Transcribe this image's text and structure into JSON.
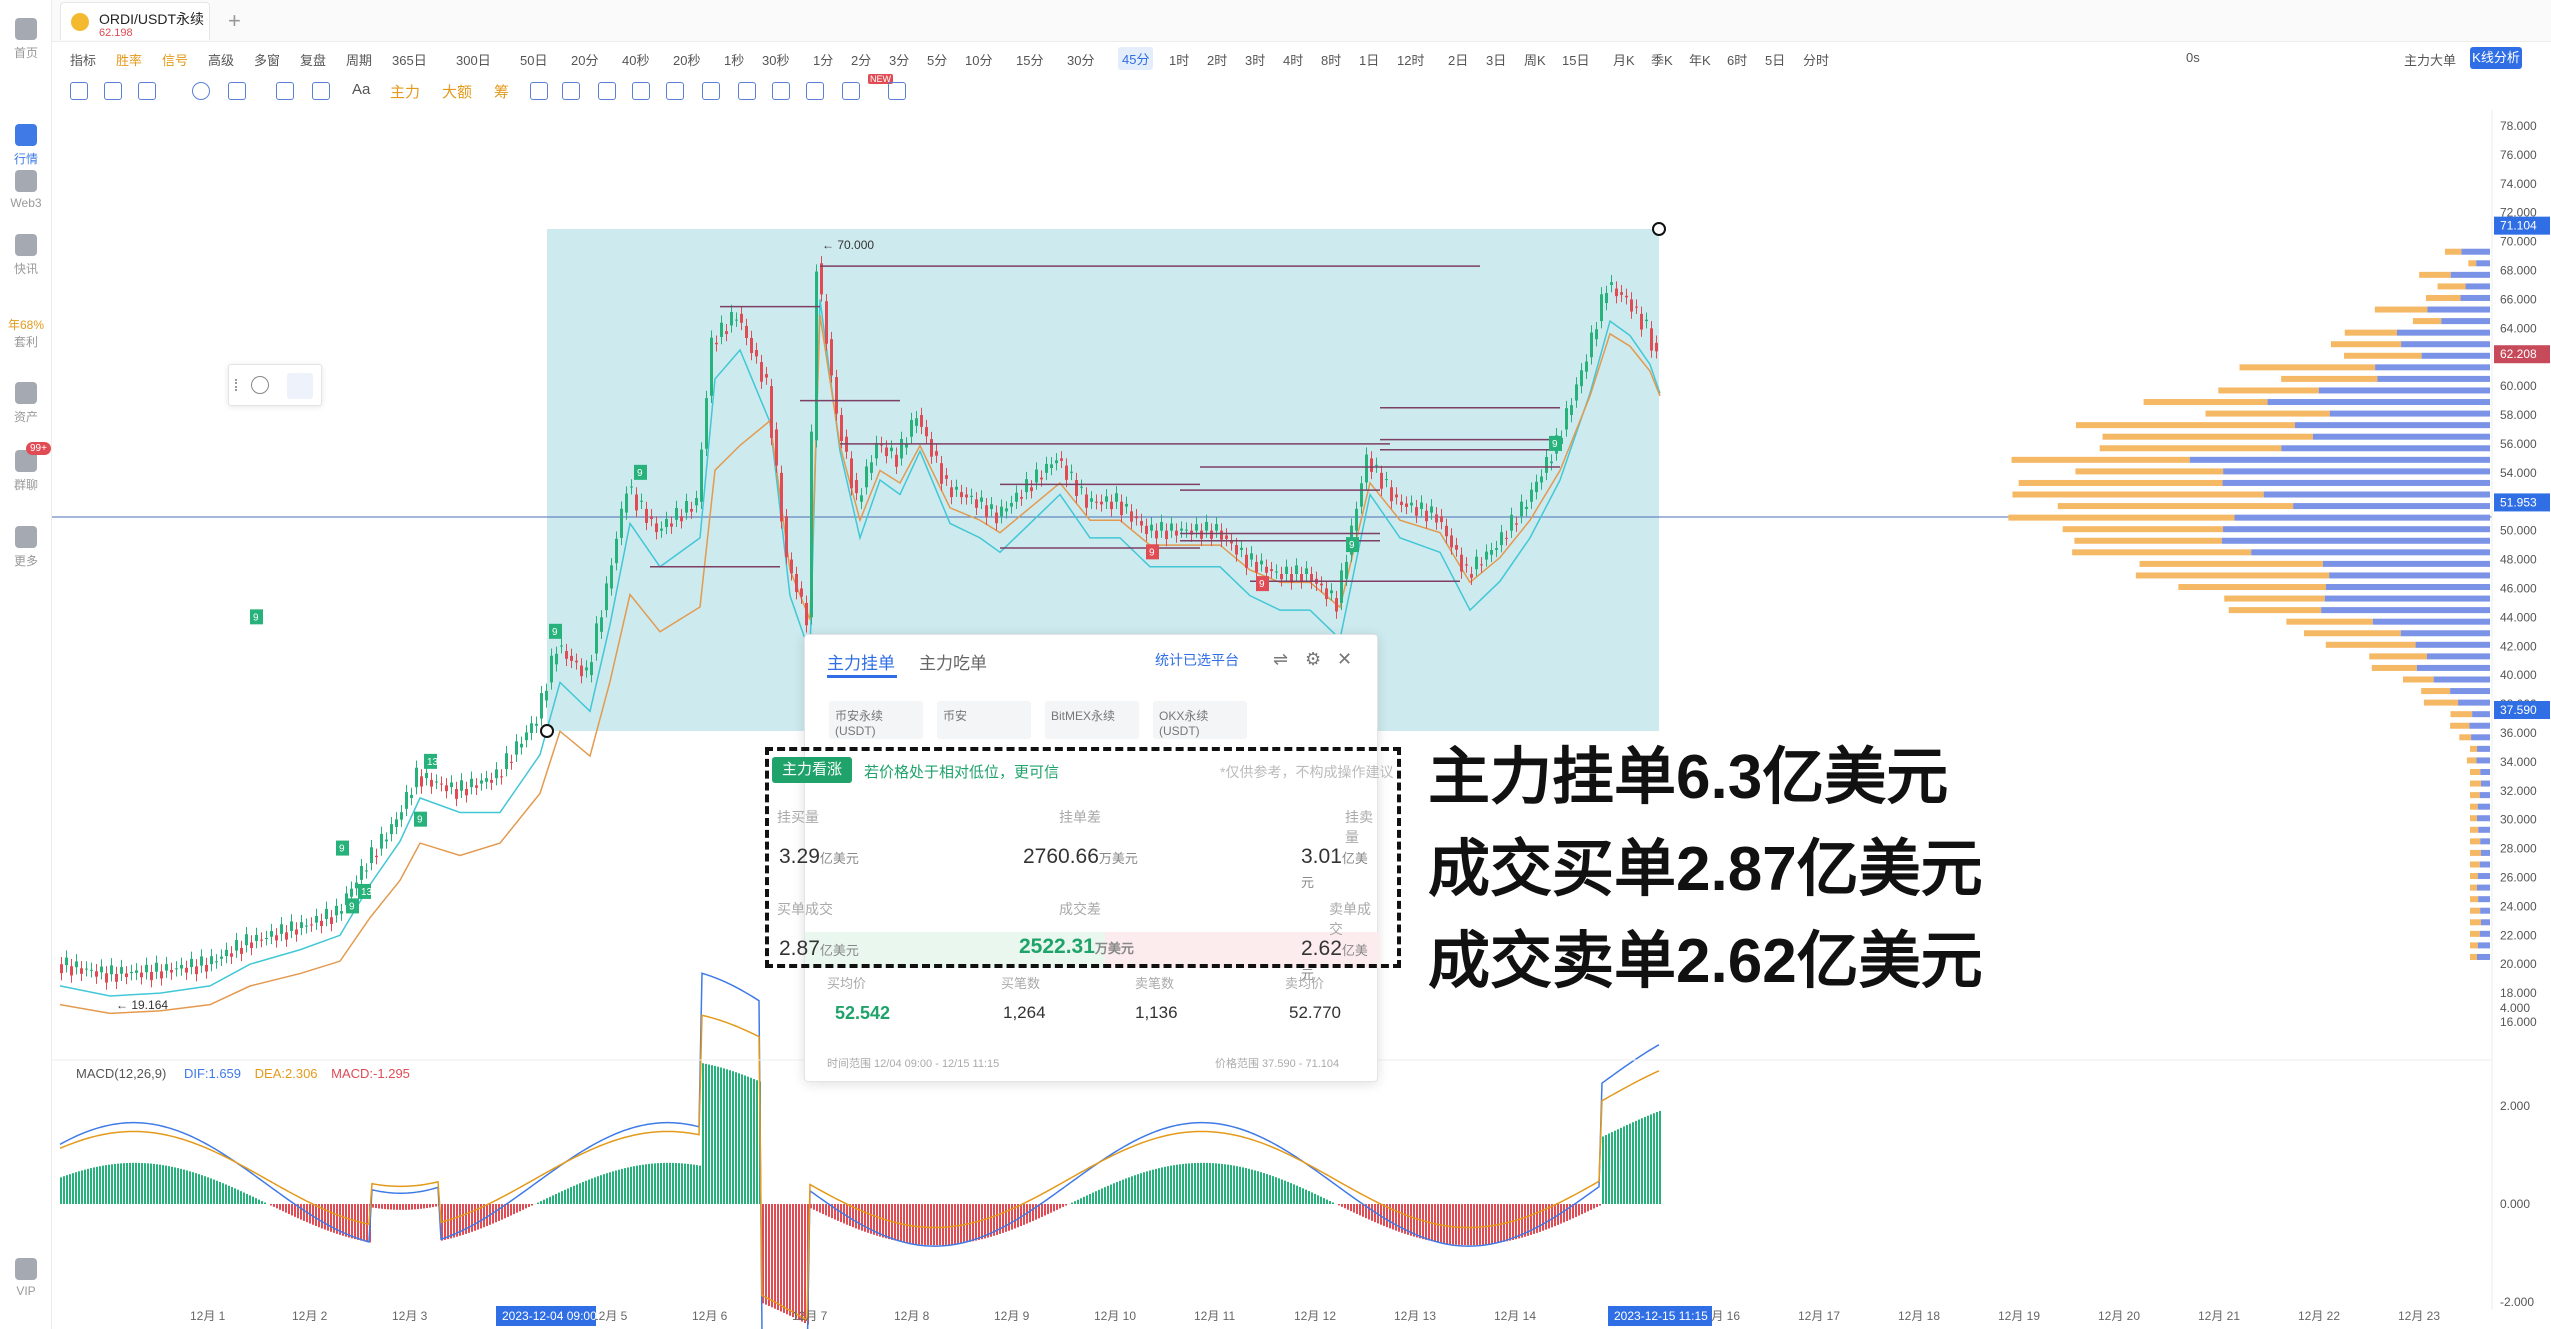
{
  "sidebar": {
    "items": [
      {
        "label": "首页",
        "icon": "home-icon"
      },
      {
        "label": "行情",
        "icon": "market-chart-icon",
        "active": true
      },
      {
        "label": "Web3",
        "icon": "web3-icon"
      },
      {
        "label": "快讯",
        "icon": "news-icon"
      },
      {
        "label": "年68%",
        "sub": "套利",
        "icon": "arbitrage-icon"
      },
      {
        "label": "资产",
        "icon": "wallet-icon"
      },
      {
        "label": "群聊",
        "badge": "99+",
        "icon": "chat-icon"
      },
      {
        "label": "更多",
        "icon": "more-grid-icon"
      },
      {
        "label": "VIP",
        "icon": "vip-diamond-icon"
      }
    ]
  },
  "tab": {
    "symbol": "ORDI/USDT永续",
    "price": "62.198",
    "add": "+"
  },
  "toolbar": {
    "items": [
      "指标",
      "胜率",
      "信号",
      "高级",
      "多窗",
      "复盘",
      "周期",
      "365日",
      "300日",
      "50日",
      "20分",
      "40秒",
      "20秒",
      "1秒",
      "30秒",
      "1分",
      "2分",
      "3分",
      "5分",
      "10分",
      "15分",
      "30分",
      "45分",
      "1时",
      "2时",
      "3时",
      "4时",
      "8时",
      "1日",
      "12时",
      "2日",
      "3日",
      "周K",
      "15日",
      "月K",
      "季K",
      "年K",
      "6时",
      "5日",
      "分时"
    ],
    "active": "45分",
    "right": {
      "latency": "0s",
      "main_force": "主力大单",
      "k_analysis": "K线分析"
    }
  },
  "drawbar": {
    "text_tool": "Aa",
    "main": "主力",
    "big": "大额",
    "chip": "筹",
    "new": "NEW"
  },
  "chart": {
    "price_axis": [
      "78.000",
      "76.000",
      "74.000",
      "72.000",
      "70.000",
      "68.000",
      "66.000",
      "64.000",
      "62.000",
      "60.000",
      "58.000",
      "56.000",
      "54.000",
      "52.000",
      "50.000",
      "48.000",
      "46.000",
      "44.000",
      "42.000",
      "40.000",
      "38.000",
      "36.000",
      "34.000",
      "32.000",
      "30.000",
      "28.000",
      "26.000",
      "24.000",
      "22.000",
      "20.000",
      "18.000",
      "16.000"
    ],
    "price_tags": {
      "high_range": "71.104",
      "current": "62.208",
      "hline": "51.953",
      "low_range": "37.590"
    },
    "high_mark": "70.000",
    "low_mark": "19.164",
    "td_counts": [
      "9",
      "9",
      "9",
      "13",
      "9",
      "13",
      "9",
      "9",
      "9",
      "9",
      "9",
      "9"
    ],
    "time_axis": [
      "12月 1",
      "12月 2",
      "12月 3",
      "12月 5",
      "12月 6",
      "12月 7",
      "12月 8",
      "12月 9",
      "12月 10",
      "12月 11",
      "12月 12",
      "12月 13",
      "12月 14",
      "12月 16",
      "12月 17",
      "12月 18",
      "12月 19",
      "12月 20",
      "12月 21",
      "12月 22",
      "12月 23"
    ],
    "time_start": "2023-12-04 09:00",
    "time_end": "2023-12-15 11:15"
  },
  "macd": {
    "label": "MACD(12,26,9)",
    "dif": "DIF:1.659",
    "dea": "DEA:2.306",
    "macd": "MACD:-1.295",
    "axis": [
      "4.000",
      "2.000",
      "0.000",
      "-2.000"
    ]
  },
  "panel": {
    "tab_active": "主力挂单",
    "tab_other": "主力吃单",
    "filter": "统计已选平台",
    "exchanges": [
      "币安永续(USDT)",
      "币安",
      "BitMEX永续",
      "OKX永续(USDT)"
    ],
    "bull_tag": "主力看涨",
    "bull_msg": "若价格处于相对低位，更可信",
    "note": "*仅供参考，不构成操作建议",
    "headers1": [
      "挂买量",
      "挂单差",
      "挂卖量"
    ],
    "row1": {
      "buy": "3.29",
      "buy_unit": "亿美元",
      "diff": "2760.66",
      "diff_unit": "万美元",
      "sell": "3.01",
      "sell_unit": "亿美元"
    },
    "headers2": [
      "买单成交",
      "成交差",
      "卖单成交"
    ],
    "row2": {
      "buy": "2.87",
      "buy_unit": "亿美元",
      "diff": "2522.31",
      "diff_unit": "万美元",
      "sell": "2.62",
      "sell_unit": "亿美元"
    },
    "headers3": [
      "买均价",
      "买笔数",
      "卖笔数",
      "卖均价"
    ],
    "row3": {
      "buy_avg": "52.542",
      "buy_cnt": "1,264",
      "sell_cnt": "1,136",
      "sell_avg": "52.770"
    },
    "time_range": "时间范围   12/04 09:00 - 12/15 11:15",
    "price_range": "价格范围   37.590 - 71.104"
  },
  "annotations": [
    "主力挂单6.3亿美元",
    "成交买单2.87亿美元",
    "成交卖单2.62亿美元"
  ],
  "colors": {
    "up": "#26b27a",
    "down": "#e04b54",
    "accent": "#2f6ee4",
    "box": "#cdeaee",
    "buy_profile": "#f5b865",
    "sell_profile": "#7b93e6"
  }
}
